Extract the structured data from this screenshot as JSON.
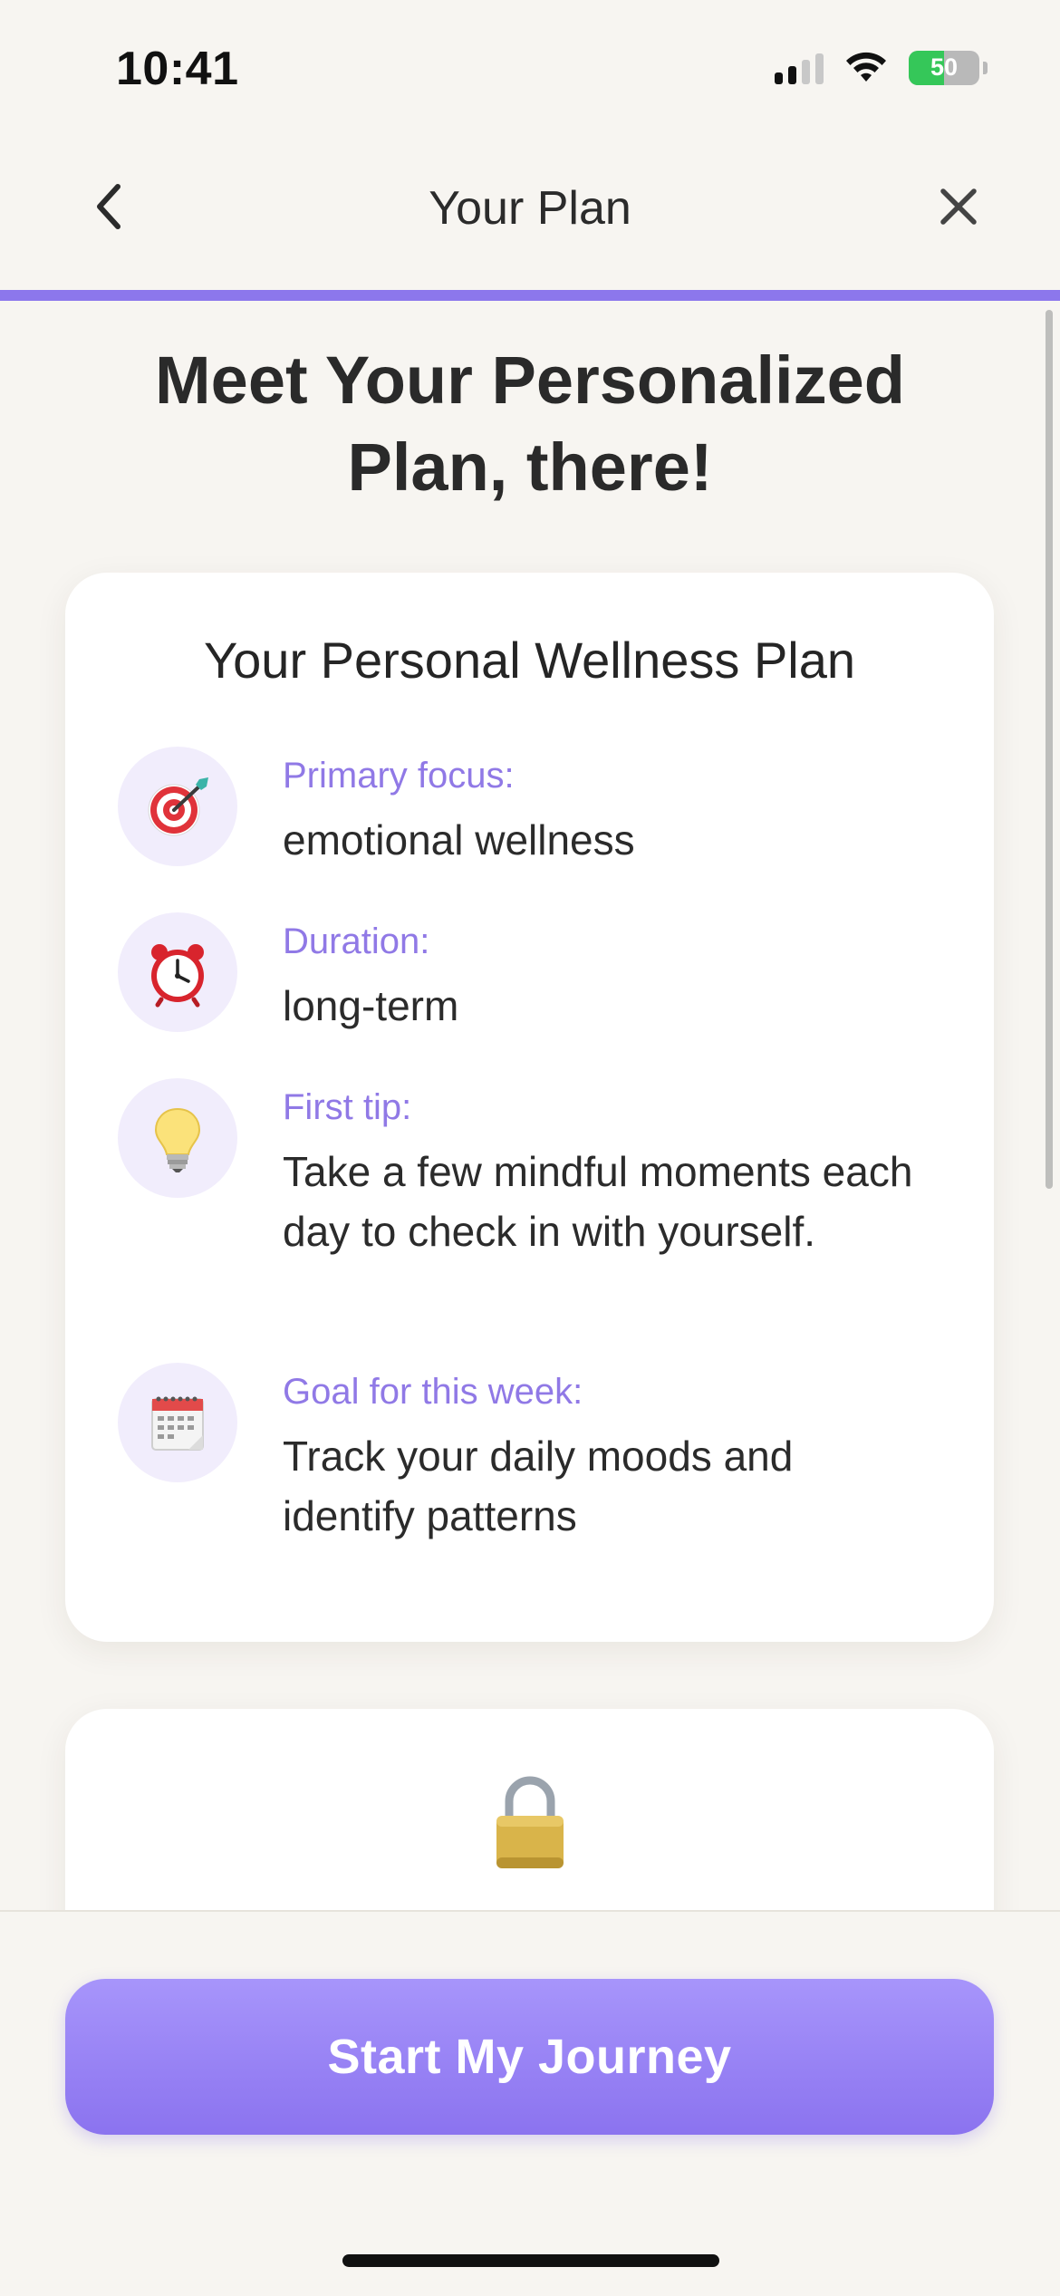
{
  "status_bar": {
    "time": "10:41",
    "battery_percent": "50",
    "battery_level": 0.5,
    "signal_bars_active": 2,
    "signal_bars_total": 4,
    "icons": [
      "cellular-signal-icon",
      "wifi-icon",
      "battery-charging-icon"
    ]
  },
  "nav": {
    "title": "Your Plan",
    "back_icon": "chevron-left-icon",
    "close_icon": "close-icon"
  },
  "progress": {
    "value": 1.0,
    "color": "#8c77ec"
  },
  "headline": "Meet Your Personalized Plan, there!",
  "plan_card": {
    "title": "Your Personal Wellness Plan",
    "items": [
      {
        "icon": "target-icon",
        "label": "Primary focus:",
        "value": "emotional wellness"
      },
      {
        "icon": "alarm-clock-icon",
        "label": "Duration:",
        "value": "long-term"
      },
      {
        "icon": "lightbulb-icon",
        "label": "First tip:",
        "value": "Take a few mindful moments each day to check in with yourself."
      },
      {
        "icon": "calendar-icon",
        "label": "Goal for this week:",
        "value": "Track your daily moods and identify patterns"
      }
    ]
  },
  "lock_card": {
    "icon": "lock-icon"
  },
  "cta": {
    "label": "Start My Journey"
  },
  "colors": {
    "background": "#f7f5f1",
    "accent": "#8c77ec",
    "label_purple": "#9079e6",
    "card": "#ffffff"
  }
}
